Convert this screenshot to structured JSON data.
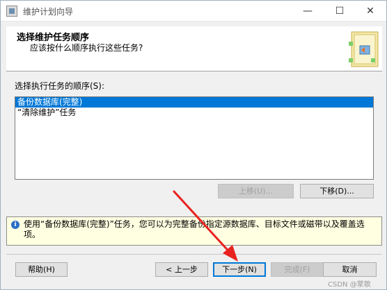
{
  "window": {
    "title": "维护计划向导",
    "controls": {
      "minimize": "—",
      "maximize": "☐",
      "close": "✕"
    }
  },
  "header": {
    "title": "选择维护任务顺序",
    "subtitle": "应该按什么顺序执行这些任务?"
  },
  "task_order": {
    "label": "选择执行任务的顺序(S):",
    "items": [
      {
        "label": "备份数据库(完整)",
        "selected": true
      },
      {
        "label": "“清除维护”任务",
        "selected": false
      }
    ]
  },
  "move_buttons": {
    "up": {
      "label": "上移(U)...",
      "enabled": false
    },
    "down": {
      "label": "下移(D)...",
      "enabled": true
    }
  },
  "info": {
    "icon": "info-icon",
    "text": "使用“备份数据库(完整)”任务，您可以为完整备份指定源数据库、目标文件或磁带以及覆盖选项。"
  },
  "footer": {
    "help": "帮助(H)",
    "back": "< 上一步",
    "next": "下一步(N)",
    "finish": "完成(F)",
    "cancel": "取消"
  },
  "watermark": "CSDN @蒙歌",
  "colors": {
    "selection": "#0078d7",
    "info_background": "#ffffe1",
    "annotation_arrow": "#e8231f"
  }
}
